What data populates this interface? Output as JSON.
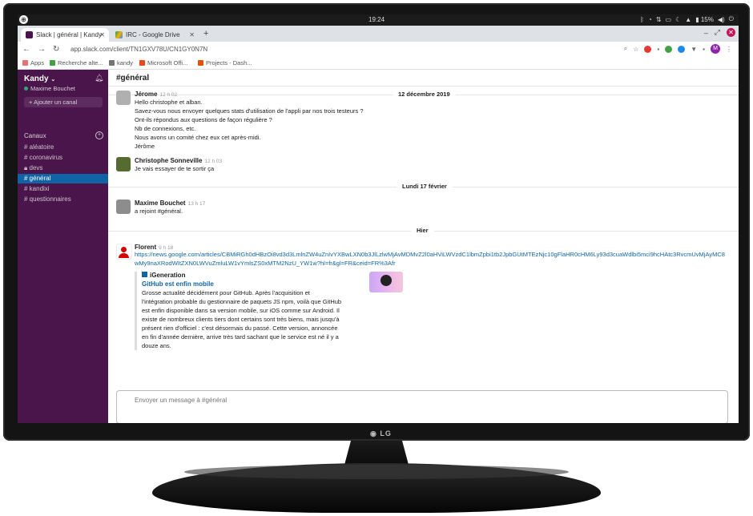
{
  "os": {
    "clock": "19:24",
    "battery": "15%"
  },
  "tabs": [
    {
      "label": "Slack | général | Kandy",
      "active": true
    },
    {
      "label": "IRC - Google Drive",
      "active": false
    }
  ],
  "toolbar": {
    "url": "app.slack.com/client/TN1GXV78U/CN1GY0N7N"
  },
  "bookmarks": [
    "Apps",
    "Recherche alte...",
    "kandy",
    "Microsoft Offi...",
    "Projects - Dash..."
  ],
  "slack": {
    "workspace": "Kandy",
    "user": "Maxime Bouchet",
    "add_channel": "Ajouter un canal",
    "channels_header": "Canaux",
    "channels": [
      "aléatoire",
      "coronavirus",
      "devs",
      "général",
      "kandixi",
      "questionnaires"
    ],
    "active_channel": "#général",
    "composer_placeholder": "Envoyer un message à #général"
  },
  "dividers": [
    "12 décembre 2019",
    "Lundi 17 février",
    "Hier"
  ],
  "messages": [
    {
      "author": "Jérome",
      "time": "12 h 02",
      "lines": [
        "Hello christophe et alban.",
        "Savez-vous nous envoyer quelques stats d'utilisation de l'appli par nos trois testeurs ?",
        "Ont-ils répondus aux questions de façon régulière ?",
        "Nb de connexions, etc.",
        "Nous avons un comité chez eux cet après-midi.",
        "Jérôme"
      ]
    },
    {
      "author": "Christophe Sonneville",
      "time": "12 h 03",
      "lines": [
        "Je vais essayer de te sortir ça"
      ]
    },
    {
      "author": "Maxime Bouchet",
      "time": "13 h 17",
      "lines": [
        "a rejoint #général."
      ]
    },
    {
      "author": "Florent",
      "time": "9 h 18",
      "link": "https://news.google.com/articles/CBMiRGh0dHBzOi8vd3d3LmlnZW4uZnIvYXBwLXN0b3JlLzlwMjAvMDMvZ2l0aHViLWVzdC1lbmZpbi1tb2JpbGUtMTEzNjc10gFlaHR0cHM6Ly93d3cuaWdlbi5mci9hcHAtc3RvcmUvMjAyMC8wMy9naXRodWItZXN0LWVuZmluLW1vYmlsZS0xMTM2NzU_YW1w?hl=fr&gl=FR&ceid=FR%3Afr",
      "attachment": {
        "source": "iGeneration",
        "title": "GitHub est enfin mobile",
        "lines": [
          "Grosse actualité décidément pour GitHub. Après l'acquisition et",
          "l'intégration probable du gestionnaire de paquets JS npm, voilà que GitHub",
          "est enfin disponible dans sa version mobile, sur iOS comme sur Android. Il",
          "existe de nombreux clients tiers dont certains sont très biens, mais jusqu'à",
          "présent rien d'officiel : c'est désormais du passé. Cette version, annoncée",
          "en fin d'année dernière, arrive très tard sachant que le service est né il y a",
          "douze ans."
        ]
      }
    }
  ],
  "monitor_brand": "LG",
  "colors": {
    "sidebar": "#4a154b",
    "active_channel": "#1164a3",
    "link": "#1264a3"
  }
}
